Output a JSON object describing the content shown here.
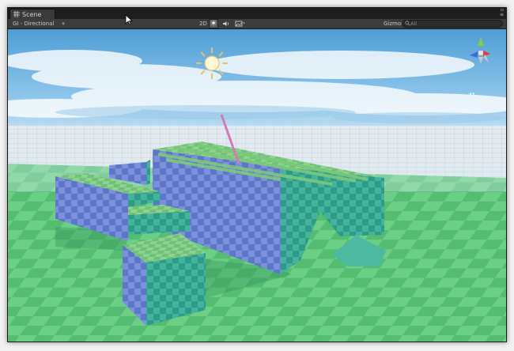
{
  "window": {
    "tab_title": "Scene"
  },
  "window_controls": {
    "menu_glyph": "▫",
    "lock_glyph": "≡"
  },
  "toolbar": {
    "shading_mode": "GI - Directional",
    "btn_2d": "2D",
    "gizmos_label": "Gizmos",
    "search_placeholder": "All"
  },
  "icons": {
    "scene_tab": "scene-grid-icon",
    "lighting": "sun-icon",
    "audio": "speaker-icon",
    "effects": "image-icon",
    "search": "search-icon",
    "orientation_gizmo": "axis-gizmo-icon",
    "sun_in_scene": "sun-icon",
    "cursor": "mouse-pointer-icon"
  },
  "colors": {
    "editor_bg": "#2a2a2a",
    "toolbar_bg": "#3c3c3c",
    "sky_top": "#4f9ed6",
    "sky_bottom": "#cfe6f6",
    "ground": "#5fc47a",
    "grid_far": "#dfe8ee",
    "checker_blue": "#7a8bd6",
    "checker_teal": "#3db59a",
    "gizmo_x": "#e03c3c",
    "gizmo_y": "#8ccc3c",
    "gizmo_z": "#3c6cd8"
  }
}
